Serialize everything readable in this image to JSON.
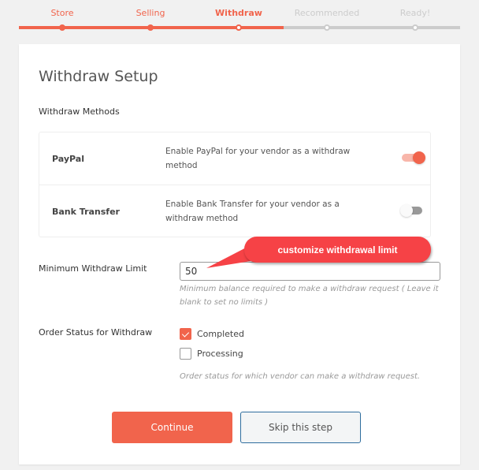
{
  "steps": [
    {
      "label": "Store",
      "state": "done"
    },
    {
      "label": "Selling",
      "state": "done"
    },
    {
      "label": "Withdraw",
      "state": "active"
    },
    {
      "label": "Recommended",
      "state": "todo"
    },
    {
      "label": "Ready!",
      "state": "todo"
    }
  ],
  "page": {
    "title": "Withdraw Setup",
    "methods_label": "Withdraw Methods"
  },
  "methods": [
    {
      "name": "PayPal",
      "description": "Enable PayPal for your vendor as a withdraw method",
      "enabled": true
    },
    {
      "name": "Bank Transfer",
      "description": "Enable Bank Transfer for your vendor as a withdraw method",
      "enabled": false
    }
  ],
  "limit": {
    "label": "Minimum Withdraw Limit",
    "value": "50",
    "hint": "Minimum balance required to make a withdraw request ( Leave it blank to set no limits )"
  },
  "order_status": {
    "label": "Order Status for Withdraw",
    "options": [
      {
        "label": "Completed",
        "checked": true
      },
      {
        "label": "Processing",
        "checked": false
      }
    ],
    "hint": "Order status for which vendor can make a withdraw request."
  },
  "buttons": {
    "continue": "Continue",
    "skip": "Skip this step"
  },
  "annotation": {
    "text": "customize withdrawal limit"
  },
  "colors": {
    "accent": "#f1644c",
    "inactive": "#cccccc",
    "annotation": "#f64246"
  }
}
